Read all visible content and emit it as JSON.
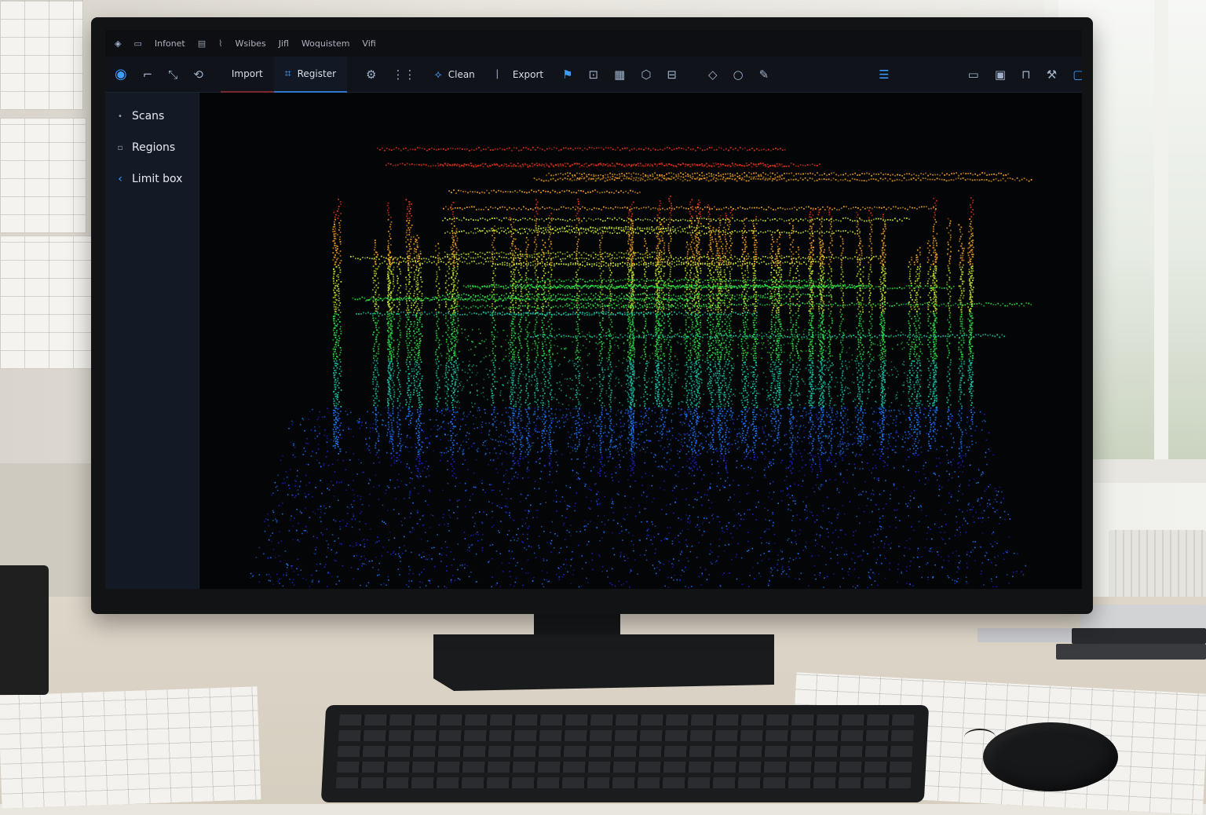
{
  "app": {
    "menu": [
      "Infonet",
      "Wsibes",
      "Jifl",
      "Woquistem",
      "Vifi"
    ],
    "toolbar": {
      "import_label": "Import",
      "register_label": "Register",
      "clean_label": "Clean",
      "export_label": "Export"
    },
    "sidebar": {
      "items": [
        {
          "label": "Scans",
          "icon": "bullet-icon"
        },
        {
          "label": "Regions",
          "icon": "bullet-icon"
        },
        {
          "label": "Limit box",
          "icon": "chevron-left-icon"
        }
      ]
    },
    "viewport": {
      "content": "point-cloud",
      "color_ramp": [
        "#1d1fd0",
        "#1b7bff",
        "#18c8a8",
        "#2ee34a",
        "#c8e530",
        "#f2a323",
        "#e8361f"
      ]
    },
    "colors": {
      "accent": "#2d78c8",
      "toolbar_bg": "#10131a",
      "sidebar_bg": "#131925"
    }
  }
}
